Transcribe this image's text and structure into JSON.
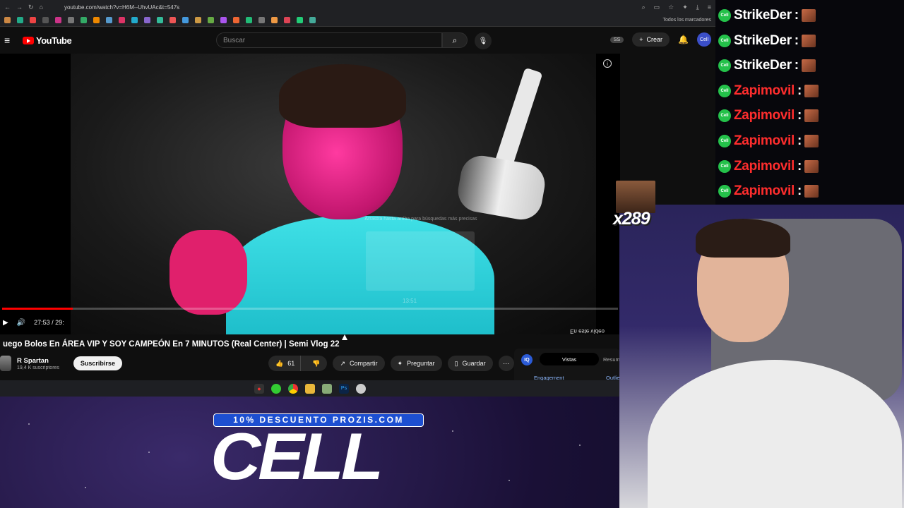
{
  "browser": {
    "url": "youtube.com/watch?v=H6M--UhvUAc&t=547s",
    "bookmarks_all": "Todos los marcadores"
  },
  "youtube": {
    "logo": "YouTube",
    "search_placeholder": "Buscar",
    "ss_badge": "SS",
    "create_label": "Crear",
    "avatar_text": "Cell"
  },
  "player": {
    "overlay_hint": "Arrastra hasta arriba para búsquedas más precisas",
    "overlay_time": "13:51",
    "time": "27:53 / 29:",
    "progress": 0.115,
    "chapter": "En este vídeo"
  },
  "video": {
    "title": "uego Bolos En ÁREA VIP Y SOY CAMPEÓN En 7 MINUTOS (Real Center) | Semi Vlog 22",
    "channel": "R Spartan",
    "subscribers": "19,4 K suscriptores",
    "subscribe_label": "Suscribirse",
    "likes": "61",
    "share_label": "Compartir",
    "ask_label": "Preguntar",
    "save_label": "Guardar"
  },
  "analytics": {
    "badge": "IQ",
    "tab_views": "Vistas",
    "tab_summary": "Resum",
    "engagement": "Engagement",
    "outline": "Outlie"
  },
  "promo": {
    "code_text": "10% DESCUENTO PROZIS.COM",
    "brand": "CELL"
  },
  "chat": {
    "badge_text": "Cell",
    "separator": ":",
    "messages": [
      {
        "user": "StrikeDer",
        "color": "#ffffff"
      },
      {
        "user": "StrikeDer",
        "color": "#ffffff"
      },
      {
        "user": "StrikeDer",
        "color": "#ffffff"
      },
      {
        "user": "Zapimovil",
        "color": "#ff2d2d"
      },
      {
        "user": "Zapimovil",
        "color": "#ff2d2d"
      },
      {
        "user": "Zapimovil",
        "color": "#ff2d2d"
      },
      {
        "user": "Zapimovil",
        "color": "#ff2d2d"
      },
      {
        "user": "Zapimovil",
        "color": "#ff2d2d"
      }
    ]
  },
  "alert": {
    "count": "x289"
  }
}
